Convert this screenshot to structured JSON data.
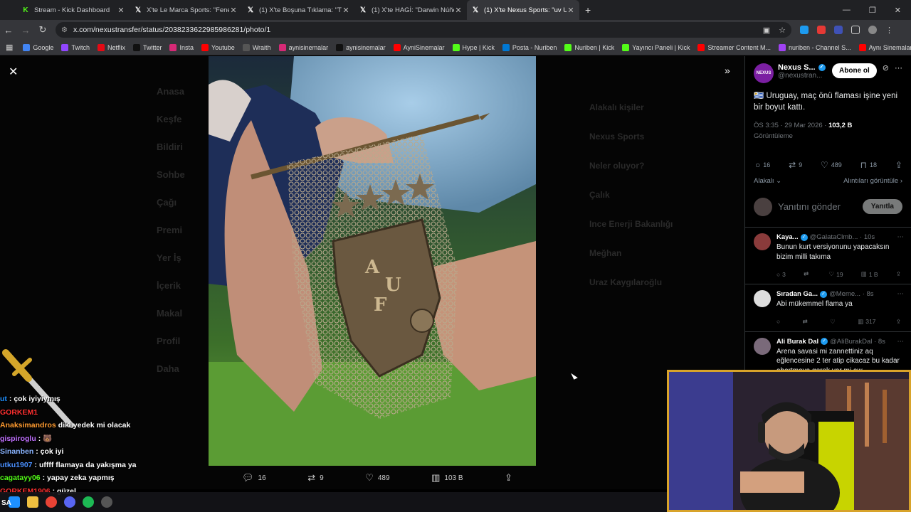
{
  "browser": {
    "tabs": [
      {
        "label": "Stream - Kick Dashboard",
        "icon": "kick-icon",
        "active": false
      },
      {
        "label": "X'te Le Marca Sports: \"Fenerbal",
        "icon": "x-icon",
        "active": false
      },
      {
        "label": "(1) X'te Boşuna Tıklama: \"TFF B",
        "icon": "x-icon",
        "active": false
      },
      {
        "label": "(1) X'te HAGİ: \"Darwin Núñez, F",
        "icon": "x-icon",
        "active": false
      },
      {
        "label": "(1) X'te Nexus Sports: \"uv Urugu",
        "icon": "x-icon",
        "active": true
      }
    ],
    "new_tab": "+",
    "url": "x.com/nexustransfer/status/2038233622985986281/photo/1",
    "bookmarks": [
      {
        "label": "Google",
        "color": "#4285f4"
      },
      {
        "label": "Twitch",
        "color": "#9146ff"
      },
      {
        "label": "Netflix",
        "color": "#e50914"
      },
      {
        "label": "Twitter",
        "color": "#111111"
      },
      {
        "label": "Insta",
        "color": "#d62976"
      },
      {
        "label": "Youtube",
        "color": "#ff0000"
      },
      {
        "label": "Wraith",
        "color": "#555555"
      },
      {
        "label": "aynisinemalar",
        "color": "#d62976"
      },
      {
        "label": "aynisinemalar",
        "color": "#111111"
      },
      {
        "label": "AyniSinemalar",
        "color": "#ff0000"
      },
      {
        "label": "Hype | Kick",
        "color": "#53fc18"
      },
      {
        "label": "Posta - Nuriben",
        "color": "#0078d4"
      },
      {
        "label": "Nuriben | Kick",
        "color": "#53fc18"
      },
      {
        "label": "Yayıncı Paneli | Kick",
        "color": "#53fc18"
      },
      {
        "label": "Streamer Content M...",
        "color": "#ff0000"
      },
      {
        "label": "nuriben - Channel S...",
        "color": "#a142f4"
      },
      {
        "label": "Aynı Sinemalar - Ça...",
        "color": "#ff0000"
      }
    ]
  },
  "background_nav": {
    "items": [
      "Anasa",
      "Keşfe",
      "Bildiri",
      "Sohbe",
      "Çağı",
      "Premi",
      "Yer İş",
      "İçerik",
      "Makal",
      "Profil",
      "Daha"
    ],
    "right": [
      "Alakalı kişiler",
      "Nexus Sports",
      "Neler oluyor?",
      "Çalık",
      "Ince Enerji Bakanlığı",
      "Meğhan",
      "Uraz Kaygılaroğlu"
    ]
  },
  "media_actions": {
    "replies": "16",
    "reposts": "9",
    "likes": "489",
    "views": "103 B"
  },
  "tweet": {
    "author_name": "Nexus S...",
    "author_handle": "@nexustran...",
    "avatar_text": "NEXUS",
    "follow_label": "Abone ol",
    "text": "🇺🇾 Uruguay, maç önü flaması işine yeni bir boyut kattı.",
    "timestamp": "ÖS 3:35 · 29 Mar 2026 · ",
    "views_count": "103,2 B",
    "views_label": "Görüntüleme",
    "stats": {
      "replies": "16",
      "reposts": "9",
      "likes": "489",
      "bookmarks": "18"
    },
    "sort_label": "Alakalı",
    "quotes_label": "Alıntıları görüntüle",
    "reply_placeholder": "Yanıtını gönder",
    "reply_button": "Yanıtla"
  },
  "replies": [
    {
      "name": "Kaya...",
      "handle": "@GalataClmb...",
      "time": "· 10s",
      "text": "Bunun kurt versiyonunu yapacaksın bizim milli takıma",
      "replies": "3",
      "reposts": "",
      "likes": "19",
      "views": "1 B",
      "avatar_color": "#8a3b3b"
    },
    {
      "name": "Sıradan Ga...",
      "handle": "@Meme...",
      "time": "· 8s",
      "text": "Abi mükemmel flama ya",
      "replies": "",
      "reposts": "",
      "likes": "",
      "views": "317",
      "avatar_color": "#dddddd"
    },
    {
      "name": "Ali Burak Dal",
      "handle": "@AliBurakDal",
      "time": "· 8s",
      "text": "Arena savasi mi zannettiniz aq eğlencesine 2 ter atip cikacaz bu kadar abartmaya gerek var mi aw",
      "replies": "",
      "reposts": "",
      "likes": "",
      "views": "",
      "avatar_color": "#7a6a7a"
    }
  ],
  "chat": [
    {
      "user": "ut",
      "user_color": "#1e90ff",
      "message": ": çok iyiyiymış"
    },
    {
      "user": "GORKEM1",
      "user_color": "#ff3030",
      "message": ""
    },
    {
      "user": "Anaksimandros",
      "user_color": "#ff9b30",
      "message": "diki yedek mi olacak"
    },
    {
      "user": "gispiroglu",
      "user_color": "#c070ff",
      "message": ": 🐻"
    },
    {
      "user": "Sinanben",
      "user_color": "#8ab4ff",
      "message": ": çok iyi"
    },
    {
      "user": "utku1907",
      "user_color": "#4a90ff",
      "message": ": uffff flamaya da yakışma ya"
    },
    {
      "user": "cagatayy06",
      "user_color": "#53fc18",
      "message": ": yapay zeka yapmış"
    },
    {
      "user": "GORKEM1906",
      "user_color": "#ff3030",
      "message": ": güzel"
    }
  ],
  "taskbar_label": "SA",
  "colors": {
    "accent_blue": "#1d9bf0",
    "kick_green": "#53fc18",
    "webcam_border": "#d8a32a"
  }
}
